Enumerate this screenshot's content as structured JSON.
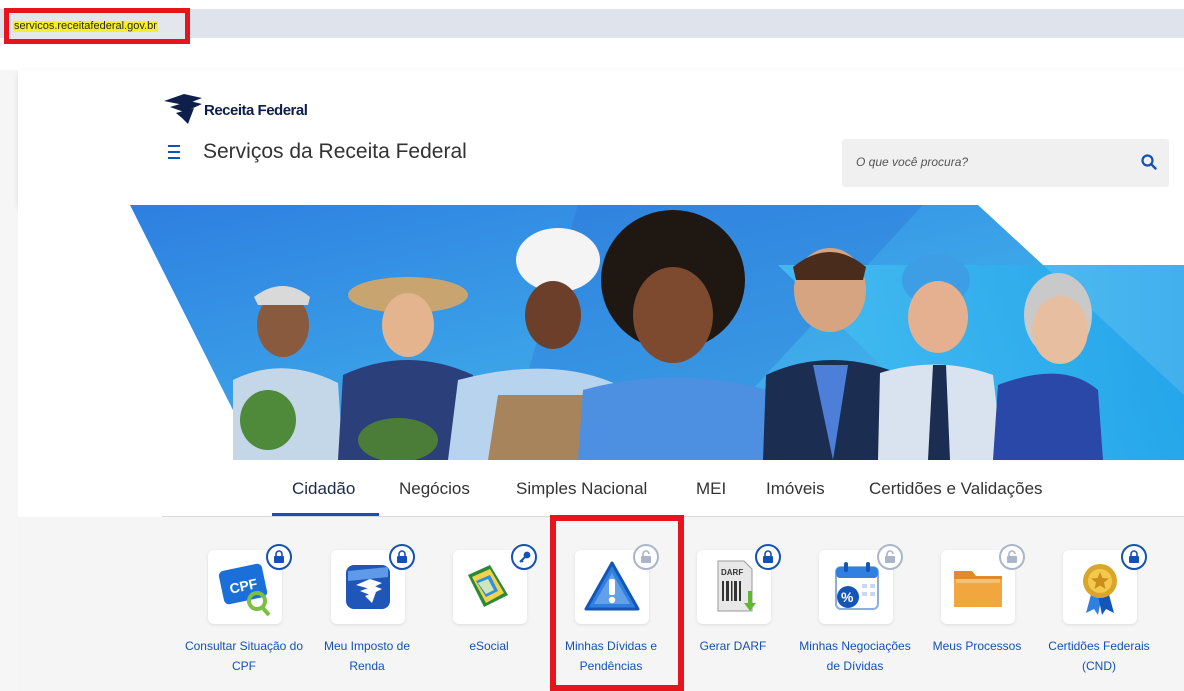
{
  "browser": {
    "url": "servicos.receitafederal.gov.br"
  },
  "header": {
    "logo_text": "Receita Federal",
    "title": "Serviços da Receita Federal",
    "search_placeholder": "O que você procura?"
  },
  "tabs": [
    {
      "label": "Cidadão",
      "active": true
    },
    {
      "label": "Negócios",
      "active": false
    },
    {
      "label": "Simples Nacional",
      "active": false
    },
    {
      "label": "MEI",
      "active": false
    },
    {
      "label": "Imóveis",
      "active": false
    },
    {
      "label": "Certidões e Validações",
      "active": false
    }
  ],
  "services": [
    {
      "label": "Consultar Situação do CPF",
      "icon": "cpf-card-icon",
      "badge": "lock-icon"
    },
    {
      "label": "Meu Imposto de Renda",
      "icon": "imposto-renda-icon",
      "badge": "lock-icon"
    },
    {
      "label": "eSocial",
      "icon": "esocial-icon",
      "badge": "key-icon"
    },
    {
      "label": "Minhas Dívidas e Pendências",
      "icon": "warning-triangle-icon",
      "badge": "unlocked-icon"
    },
    {
      "label": "Gerar DARF",
      "icon": "darf-document-icon",
      "badge": "lock-icon"
    },
    {
      "label": "Minhas Negociações de Dívidas",
      "icon": "calendar-percent-icon",
      "badge": "unlocked-icon"
    },
    {
      "label": "Meus Processos",
      "icon": "folder-icon",
      "badge": "unlocked-icon"
    },
    {
      "label": "Certidões Federais (CND)",
      "icon": "certificate-medal-icon",
      "badge": "lock-icon"
    }
  ],
  "colors": {
    "primary": "#1351b4",
    "highlight": "#e8141c",
    "url_highlight": "#f4ef27"
  }
}
